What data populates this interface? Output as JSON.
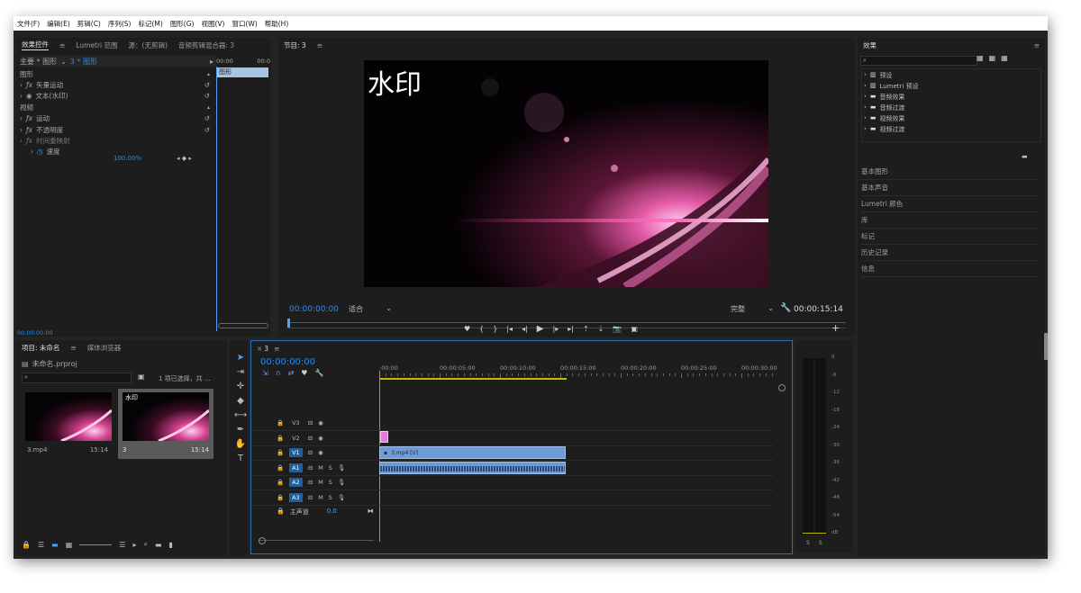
{
  "menu": [
    "文件(F)",
    "编辑(E)",
    "剪辑(C)",
    "序列(S)",
    "标记(M)",
    "图形(G)",
    "视图(V)",
    "窗口(W)",
    "帮助(H)"
  ],
  "effect_controls": {
    "tabs": [
      "效果控件",
      "Lumetri 范围",
      "源：(无剪辑)",
      "音频剪辑混合器: 3"
    ],
    "breadcrumb_master": "主要 * 图形",
    "breadcrumb_clip": "3 * 图形",
    "timecode_start": "00:00",
    "timecode_end": "00:0",
    "clip_label": "图形",
    "rows": [
      {
        "label": "图形",
        "indent": 0,
        "fx": ""
      },
      {
        "label": "矢量运动",
        "indent": 1,
        "fx": "fx"
      },
      {
        "label": "文本(水印)",
        "indent": 1,
        "fx": "eye"
      },
      {
        "label": "视频",
        "indent": 0,
        "fx": ""
      },
      {
        "label": "运动",
        "indent": 1,
        "fx": "fx"
      },
      {
        "label": "不透明度",
        "indent": 1,
        "fx": "fx"
      },
      {
        "label": "时间重映射",
        "indent": 1,
        "fx": "fx-dim"
      },
      {
        "label": "速度",
        "indent": 2,
        "fx": "clock"
      }
    ],
    "speed_value": "100.00%",
    "bottom_timecode": "00:00:00:00"
  },
  "program": {
    "title": "节目: 3",
    "watermark": "水印",
    "timecode": "00:00:00:00",
    "fit": "适合",
    "quality": "完整",
    "duration": "00:00:15:14"
  },
  "project": {
    "tabs": [
      "项目: 未命名",
      "媒体浏览器"
    ],
    "file": "未命名.prproj",
    "selection": "1 项已选择，共 ...",
    "items": [
      {
        "name": "3.mp4",
        "duration": "15:14",
        "selected": false
      },
      {
        "name": "3",
        "duration": "15:14",
        "selected": true,
        "overlay": "水印"
      }
    ]
  },
  "timeline": {
    "seq_tab": "3",
    "timecode": "00:00:00:00",
    "ruler": [
      ":00:00",
      "00:00:05:00",
      "00:00:10:00",
      "00:00:15:00",
      "00:00:20:00",
      "00:00:25:00",
      "00:00:30:00"
    ],
    "video_tracks": [
      "V3",
      "V2",
      "V1"
    ],
    "audio_tracks": [
      "A1",
      "A2",
      "A3"
    ],
    "master": "主声道",
    "master_value": "0.0",
    "clip_label": "3.mp4 [V]"
  },
  "meter": {
    "scale": [
      "0",
      "-6",
      "-12",
      "-18",
      "-24",
      "-30",
      "-36",
      "-42",
      "-48",
      "-54",
      "dB"
    ],
    "solo": [
      "S",
      "S"
    ]
  },
  "effects_panel": {
    "title": "效果",
    "folders": [
      "预设",
      "Lumetri 预设",
      "音频效果",
      "音频过渡",
      "视频效果",
      "视频过渡"
    ],
    "sections": [
      "基本图形",
      "基本声音",
      "Lumetri 颜色",
      "库",
      "标记",
      "历史记录",
      "信息"
    ]
  },
  "colors": {
    "accent": "#2d8ceb",
    "clip_video": "#6f9bd6",
    "clip_audio": "#6f9bd6",
    "graphic_clip": "#e57bd8",
    "playhead": "#4aa3ff"
  }
}
